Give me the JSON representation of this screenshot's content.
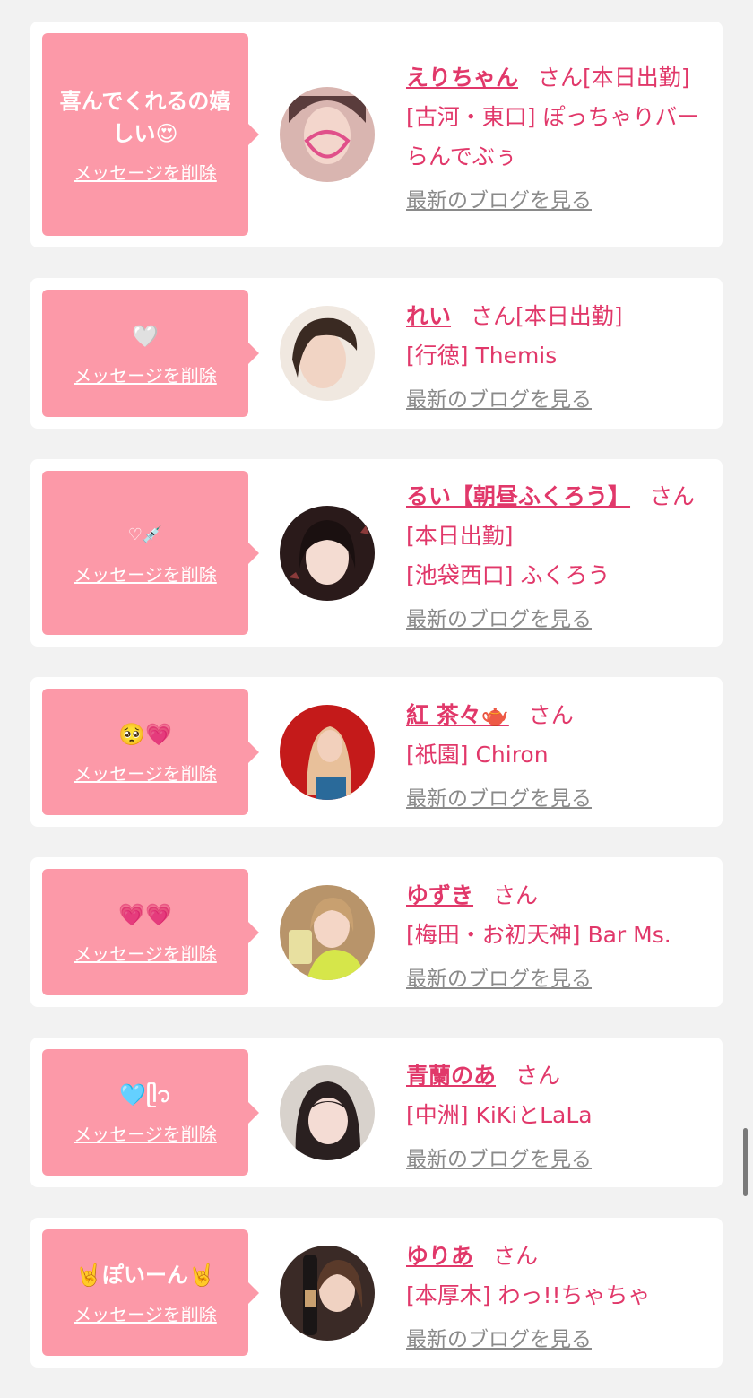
{
  "delete_label": "メッセージを削除",
  "blog_label": "最新のブログを見る",
  "san_label": "さん",
  "items": [
    {
      "message": "喜んでくれるの嬉しい😍",
      "name": "えりちゃん",
      "status": "[本日出勤]",
      "location": "[古河・東口] ぽっちゃりバー らんでぶぅ",
      "avatar_colors": [
        "#d9b5b0",
        "#5a3c3c"
      ]
    },
    {
      "message": "🤍",
      "name": "れい",
      "status": "[本日出勤]",
      "location": "[行徳] Themis",
      "avatar_colors": [
        "#f0e8e0",
        "#3a2a22"
      ]
    },
    {
      "message": "♡💉",
      "name": "るい【朝昼ふくろう】",
      "status": "[本日出勤]",
      "location": "[池袋西口] ふくろう",
      "avatar_colors": [
        "#2a1a1a",
        "#8a3a3a"
      ]
    },
    {
      "message": "🥺💗",
      "name": "紅 茶々🫖",
      "status": "",
      "location": "[祇園] Chiron",
      "avatar_colors": [
        "#c41a1a",
        "#e8c09a"
      ]
    },
    {
      "message": "💗💗",
      "name": "ゆずき",
      "status": "",
      "location": "[梅田・お初天神] Bar Ms.",
      "avatar_colors": [
        "#b8946a",
        "#d6e64a"
      ]
    },
    {
      "message": "🩵ᥫ᭡",
      "name": "青蘭のあ",
      "status": "",
      "location": "[中洲] KiKiとLaLa",
      "avatar_colors": [
        "#d8d2cc",
        "#2a2020"
      ]
    },
    {
      "message": "🤘ぽいーん🤘",
      "name": "ゆりあ",
      "status": "",
      "location": "[本厚木] わっ!!ちゃちゃ",
      "avatar_colors": [
        "#3a2a26",
        "#c8a070"
      ]
    }
  ],
  "colors": {
    "accent": "#e1386a",
    "bubble": "#fc99a8",
    "muted": "#8a8a8a",
    "background": "#f2f2f2"
  }
}
